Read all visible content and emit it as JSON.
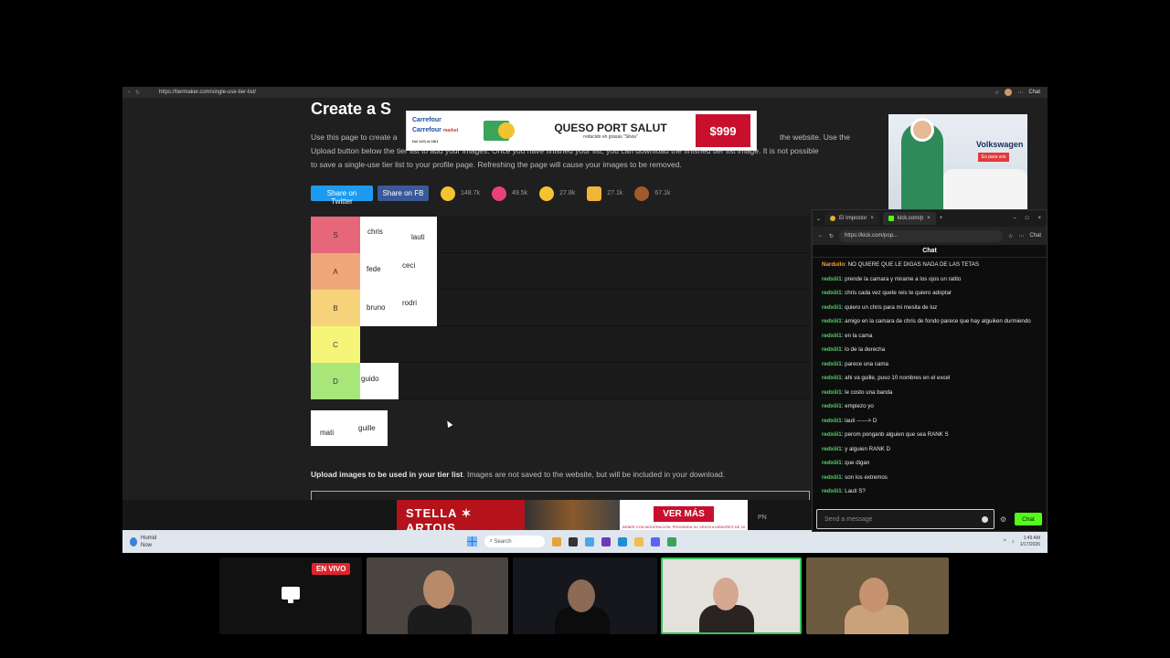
{
  "browser": {
    "url": "https://tiermaker.com/single-use-tier-list/",
    "chat_label": "Chat"
  },
  "page": {
    "title": "Create a S",
    "intro_left": "Use this page to create a",
    "intro_right": "the website. Use the",
    "intro_line2": "Upload button below the tier list to add your images. Once you have finished your list, you can download the finished tier list image. It is not possible",
    "intro_line3": "to save a single-use tier list to your profile page. Refreshing the page will cause your images to be removed.",
    "share_twitter": "Share on Twitter",
    "share_fb": "Share on FB",
    "reactions": [
      {
        "icon": "grin-emoji-icon",
        "count": "148.7k"
      },
      {
        "icon": "heart-eyes-emoji-icon",
        "count": "49.5k"
      },
      {
        "icon": "laughing-emoji-icon",
        "count": "27.8k"
      },
      {
        "icon": "raised-hands-emoji-icon",
        "count": "27.1k"
      },
      {
        "icon": "poop-emoji-icon",
        "count": "67.1k"
      }
    ],
    "tiers": [
      {
        "label": "S",
        "color": "#e6677a",
        "items": [
          "chris",
          "lauti"
        ]
      },
      {
        "label": "A",
        "color": "#f0a87a",
        "items": [
          "fede",
          "ceci"
        ]
      },
      {
        "label": "B",
        "color": "#f6d37a",
        "items": [
          "bruno",
          "rodri"
        ]
      },
      {
        "label": "C",
        "color": "#f5f57a",
        "items": []
      },
      {
        "label": "D",
        "color": "#a8e67a",
        "items": [
          "guido"
        ]
      }
    ],
    "unranked": [
      "mati",
      "guille"
    ],
    "upload_bold": "Upload images to be used in your tier list",
    "upload_rest": ". Images are not saved to the website, but will be included in your download."
  },
  "ads": {
    "top": {
      "brand1": "Carrefour",
      "brand2": "Carrefour",
      "brand2_sub": "market",
      "headline": "QUESO PORT SALUT",
      "subline": "reducido en grasas \"Silvia\"",
      "fine": "Del 12/1 al 18/1",
      "price": "$999"
    },
    "side": {
      "brand": "Volkswagen",
      "cta": "Es para vos"
    },
    "bottom": {
      "brand": "STELLA ✶ ARTOIS",
      "cta": "VER MÁS",
      "fine": "BEBER CON MODERACIÓN. PROHIBIDA SU VENTA A MENORES DE 18 AÑOS"
    },
    "pn": "PN"
  },
  "taskbar": {
    "weather_title": "Humid",
    "weather_sub": "Now",
    "search": "Search",
    "time": "1:49 AM",
    "date": "1/17/2026"
  },
  "kick": {
    "tab1": "El Impostor",
    "tab2": "kick.com/p",
    "url": "https://kick.com/pop...",
    "nav_chat": "Chat",
    "chat_title": "Chat",
    "messages": [
      {
        "user": "Narduilo",
        "text": "NO QUIERE QUE LE DIGAS NADA DE LAS TETAS",
        "orange": true
      },
      {
        "user": "redxiii1",
        "text": "prende la camara y mirame a los ojos un ratito"
      },
      {
        "user": "redxiii1",
        "text": "chris cada vez quete reis te quiero adoptar"
      },
      {
        "user": "redxiii1",
        "text": "quiero un chris para mi mesita de luz"
      },
      {
        "user": "redxiii1",
        "text": "amigo en la camara de chris de fondo parece que hay alguiken durmiendo"
      },
      {
        "user": "redxiii1",
        "text": "en la cama"
      },
      {
        "user": "redxiii1",
        "text": "lo de la derecha"
      },
      {
        "user": "redxiii1",
        "text": "parece una cama"
      },
      {
        "user": "redxiii1",
        "text": "ahi va guille, puso 10 nombres en el excel"
      },
      {
        "user": "redxiii1",
        "text": "le costo una banda"
      },
      {
        "user": "redxiii1",
        "text": "empiezo yo"
      },
      {
        "user": "redxiii1",
        "text": "lauti ------> D"
      },
      {
        "user": "redxiii1",
        "text": "perom ponganb alguien que sea RANK S"
      },
      {
        "user": "redxiii1",
        "text": "y alguien RANK D"
      },
      {
        "user": "redxiii1",
        "text": "que digan"
      },
      {
        "user": "redxiii1",
        "text": "son los extremos"
      },
      {
        "user": "redxiii1",
        "text": "Lauti S?"
      }
    ],
    "input_placeholder": "Send a message",
    "send_label": "Chat"
  },
  "cams": {
    "live_label": "EN VIVO"
  }
}
